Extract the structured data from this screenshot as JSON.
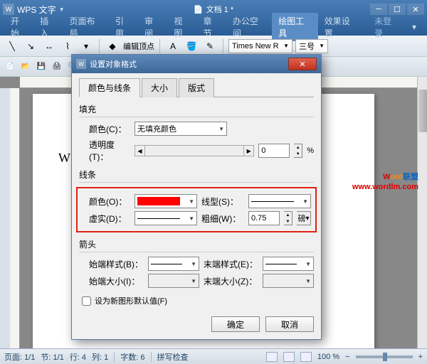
{
  "app": {
    "name": "WPS 文字",
    "icon_letter": "W",
    "doc_name": "文档 1 *",
    "unregistered": "未登录"
  },
  "menus": [
    "开始",
    "插入",
    "页面布局",
    "引用",
    "审阅",
    "视图",
    "章节",
    "办公空间",
    "绘图工具",
    "效果设置"
  ],
  "active_menu": 8,
  "toolbar1": {
    "edit_vertex": "编辑顶点",
    "font": "Times New R",
    "size": "三号"
  },
  "dialog": {
    "title": "设置对象格式",
    "tabs": [
      "颜色与线条",
      "大小",
      "版式"
    ],
    "active_tab": 0,
    "fill": {
      "legend": "填充",
      "color_label": "颜色(C)：",
      "color_value": "无填充颜色",
      "trans_label": "透明度(T)：",
      "trans_value": "0",
      "trans_unit": "%"
    },
    "line": {
      "legend": "线条",
      "color_label": "颜色(O)：",
      "style_label": "线型(S)：",
      "dash_label": "虚实(D)：",
      "weight_label": "粗细(W)：",
      "weight_value": "0.75",
      "weight_unit": "磅"
    },
    "arrow": {
      "legend": "箭头",
      "begin_style_label": "始端样式(B)：",
      "end_style_label": "末端样式(E)：",
      "begin_size_label": "始端大小(I)：",
      "end_size_label": "末端大小(Z)："
    },
    "default_chk": "设为新图形默认值(F)",
    "ok": "确定",
    "cancel": "取消"
  },
  "doc_content": "W",
  "watermark": {
    "brand_w": "W",
    "brand_ord": "ord",
    "brand_cn": "联盟",
    "url": "www.wordlm.com"
  },
  "status": {
    "page": "页面: 1/1",
    "section": "节: 1/1",
    "line": "行: 4",
    "col": "列: 1",
    "chars": "字数: 6",
    "spell": "拼写检查",
    "zoom": "100 %"
  }
}
